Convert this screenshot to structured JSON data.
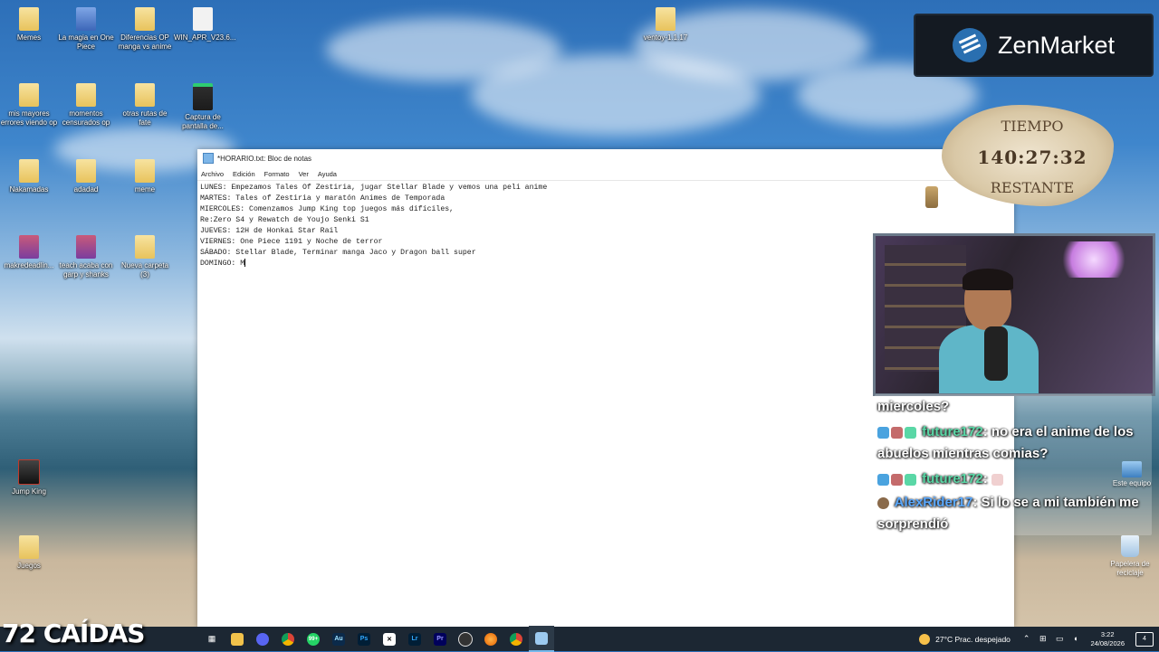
{
  "desktop_icons": [
    {
      "label": "Memes",
      "icon": "folder-icon"
    },
    {
      "label": "La magia en One Piece",
      "icon": "word-document-icon"
    },
    {
      "label": "Diferencias OP manga vs anime",
      "icon": "folder-icon"
    },
    {
      "label": "WIN_APR_V23.6...",
      "icon": "file-icon"
    },
    {
      "label": "mis mayores errores viendo op",
      "icon": "folder-icon"
    },
    {
      "label": "momentos censurados op",
      "icon": "folder-icon"
    },
    {
      "label": "otras rutas de fate",
      "icon": "folder-icon"
    },
    {
      "label": "Captura de pantalla de...",
      "icon": "screenshot-icon"
    },
    {
      "label": "Nakamadas",
      "icon": "folder-icon"
    },
    {
      "label": "adadad",
      "icon": "folder-icon"
    },
    {
      "label": "meme",
      "icon": "folder-icon"
    },
    {
      "label": "makredeadlin...",
      "icon": "image-icon"
    },
    {
      "label": "teach acaba con garp y shanks",
      "icon": "image-icon"
    },
    {
      "label": "Nueva carpeta (3)",
      "icon": "folder-icon"
    },
    {
      "label": "Jump King",
      "icon": "game-icon"
    },
    {
      "label": "Juegos",
      "icon": "folder-icon"
    },
    {
      "label": "ventoy-1.1.17",
      "icon": "folder-icon"
    }
  ],
  "notepad": {
    "title": "*HORARIO.txt: Bloc de notas",
    "menu": [
      "Archivo",
      "Edición",
      "Formato",
      "Ver",
      "Ayuda"
    ],
    "lines": [
      "LUNES: Empezamos Tales Of Zestiria, jugar Stellar Blade y vemos una peli anime",
      "MARTES: Tales of Zestiria y maratón Animes de Temporada",
      "MIERCOLES: Comenzamos Jump King top juegos más difíciles,",
      "Re:Zero S4 y Rewatch de Youjo Senki S1",
      "JUEVES: 12H de Honkai Star Rail",
      "VIERNES: One Piece 1191 y Noche de terror",
      "SÁBADO: Stellar Blade, Terminar manga Jaco y Dragon ball super",
      "DOMINGO: M"
    ]
  },
  "overlay": {
    "brand": "ZenMarket",
    "timer_top": "TIEMPO",
    "timer_value": "140:27:32",
    "timer_bottom": "RESTANTE",
    "caidas": "72 CAÍDAS"
  },
  "chat": {
    "messages": [
      {
        "text": "miercoles?"
      },
      {
        "user": "future172",
        "text": ": no era el anime de los abuelos mientras comias?"
      },
      {
        "user": "future172",
        "text": ":"
      },
      {
        "user": "AlexRider17",
        "text": ": Si lo se a mi también me sorprendió"
      }
    ]
  },
  "right_icons": {
    "pc": "Este equipo",
    "bin": "Papelera de reciclaje"
  },
  "taskbar": {
    "badge": "99+",
    "apps": [
      "Au",
      "Ps",
      "Lr",
      "Pr"
    ],
    "weather": "27°C  Prac. despejado",
    "time": "3:22",
    "date": "24/08/2026"
  }
}
